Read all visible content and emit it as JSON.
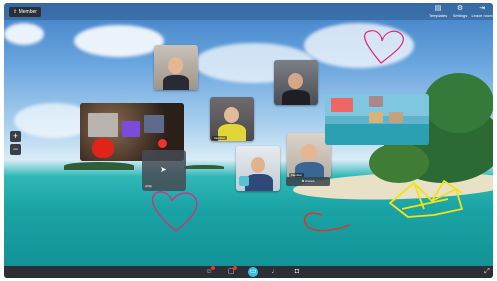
{
  "top_bar": {
    "member_button_label": "Member",
    "actions": [
      {
        "label": "Templates",
        "icon": "templates-icon"
      },
      {
        "label": "Settings",
        "icon": "gear-icon"
      },
      {
        "label": "Leave room",
        "icon": "leave-icon"
      }
    ]
  },
  "zoom": {
    "in": "+",
    "out": "−"
  },
  "participants": [
    {
      "name": ""
    },
    {
      "name": ""
    },
    {
      "name": "Member"
    },
    {
      "name": ""
    },
    {
      "name": ""
    },
    {
      "name": "Member"
    }
  ],
  "philip_card": {
    "name": "philip"
  },
  "screen_share": {
    "label": "shared"
  },
  "bottom_bar": {
    "buttons": [
      {
        "icon": "reactions-icon",
        "badge": true
      },
      {
        "icon": "chat-icon",
        "badge": true
      },
      {
        "icon": "screen-share-icon",
        "active": true
      },
      {
        "icon": "microphone-icon"
      },
      {
        "icon": "camera-icon"
      },
      {
        "icon": "fullscreen-icon"
      }
    ]
  },
  "annotation_colors": {
    "pink": "#e0287a",
    "red": "#e5321d",
    "yellow": "#f1e21a"
  }
}
